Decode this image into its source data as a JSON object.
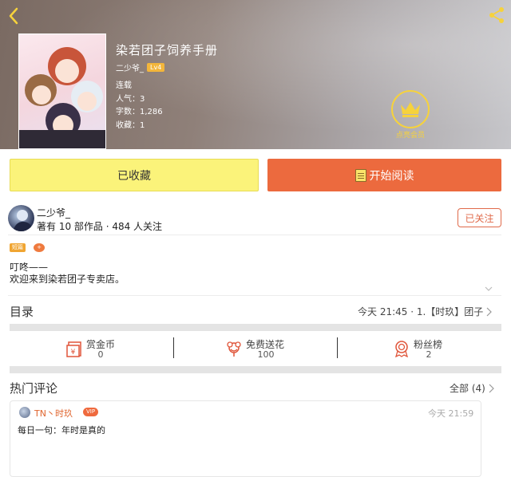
{
  "header": {
    "book_title": "染若团子饲养手册",
    "author_name": "二少爷_",
    "author_level": "Lv4",
    "status": "连载",
    "popularity": "人气：3",
    "word_count": "字数：1,286",
    "favorites": "收藏：1",
    "vip_label": "点亮会员"
  },
  "actions": {
    "favorited_label": "已收藏",
    "read_label": "开始阅读"
  },
  "author": {
    "name": "二少爷_",
    "stats": "著有 10 部作品 · 484 人关注",
    "follow_label": "已关注"
  },
  "tags": [
    "短篇",
    "+"
  ],
  "intro": {
    "line1": "叮咚——",
    "line2": "欢迎来到染若团子专卖店。"
  },
  "toc": {
    "label": "目录",
    "latest": "今天 21:45 · 1.【时玖】团子"
  },
  "stats": [
    {
      "label": "赏金币",
      "value": "0",
      "icon": "gift-box-icon"
    },
    {
      "label": "免费送花",
      "value": "100",
      "icon": "flower-icon"
    },
    {
      "label": "粉丝榜",
      "value": "2",
      "icon": "medal-icon"
    }
  ],
  "comments": {
    "label": "热门评论",
    "all": "全部 (4)",
    "items": [
      {
        "user": "TN丶时玖",
        "vip": "VIP",
        "time": "今天 21:59",
        "text": "每日一句：年时是真的"
      }
    ]
  },
  "colors": {
    "accent": "#ec6a3e",
    "favorite_bg": "#fbf37a",
    "vip_gold": "#f6d23c",
    "level_badge": "#f3b63b"
  }
}
